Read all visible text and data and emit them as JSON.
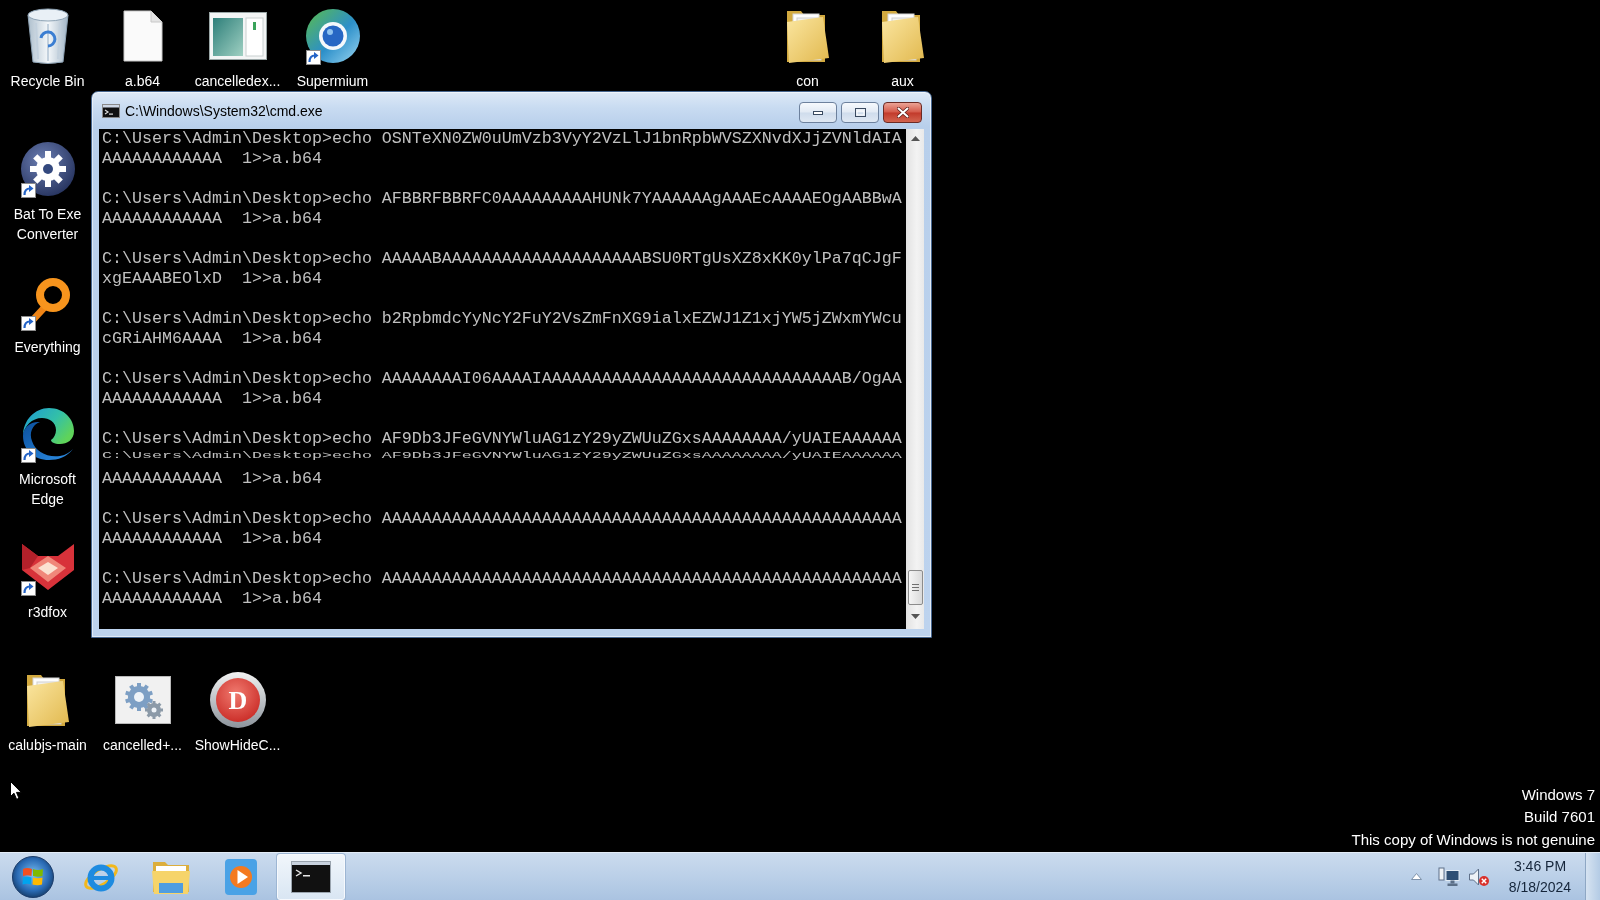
{
  "desktop_icons": [
    {
      "label": "Recycle Bin",
      "kind": "recycle-bin",
      "shortcut": false
    },
    {
      "label": "a.b64",
      "kind": "document",
      "shortcut": false
    },
    {
      "label": "cancelledex...",
      "kind": "thumbnail",
      "shortcut": false
    },
    {
      "label": "Supermium",
      "kind": "globe",
      "shortcut": true
    },
    {
      "label": "con",
      "kind": "folder",
      "shortcut": false
    },
    {
      "label": "aux",
      "kind": "folder",
      "shortcut": false
    },
    {
      "label": "Bat To Exe Converter",
      "kind": "gear",
      "shortcut": true
    },
    {
      "label": "Everything",
      "kind": "ring",
      "shortcut": true
    },
    {
      "label": "Microsoft Edge",
      "kind": "swirl",
      "shortcut": true
    },
    {
      "label": "r3dfox",
      "kind": "fox",
      "shortcut": true
    },
    {
      "label": "calubjs-main",
      "kind": "folder",
      "shortcut": false
    },
    {
      "label": "cancelled+...",
      "kind": "gears",
      "shortcut": false
    },
    {
      "label": "ShowHideC...",
      "kind": "letter-disc",
      "glyph": "D",
      "shortcut": false
    }
  ],
  "console_window": {
    "title": "C:\\Windows\\System32\\cmd.exe",
    "lines": [
      {
        "kind": "text",
        "text": "C:\\Users\\Admin\\Desktop>echo OSNTeXN0ZW0uUmVzb3VyY2VzLlJ1bnRpbWVSZXNvdXJjZVNldAIA"
      },
      {
        "kind": "text",
        "text": "AAAAAAAAAAAA  1>>a.b64"
      },
      {
        "kind": "blank"
      },
      {
        "kind": "text",
        "text": "C:\\Users\\Admin\\Desktop>echo AFBBRFBBRFC0AAAAAAAAAHUNk7YAAAAAAgAAAEcAAAAEOgAABBwA"
      },
      {
        "kind": "text",
        "text": "AAAAAAAAAAAA  1>>a.b64"
      },
      {
        "kind": "blank"
      },
      {
        "kind": "text",
        "text": "C:\\Users\\Admin\\Desktop>echo AAAAABAAAAAAAAAAAAAAAAAAAABSU0RTgUsXZ8xKK0ylPa7qCJgF"
      },
      {
        "kind": "text",
        "text": "xgEAAABEOlxD  1>>a.b64"
      },
      {
        "kind": "blank"
      },
      {
        "kind": "text",
        "text": "C:\\Users\\Admin\\Desktop>echo b2RpbmdcYyNcY2FuY2VsZmFnXG9ialxEZWJ1Z1xjYW5jZWxmYWcu"
      },
      {
        "kind": "text",
        "text": "cGRiAHM6AAAA  1>>a.b64"
      },
      {
        "kind": "blank"
      },
      {
        "kind": "text",
        "text": "C:\\Users\\Admin\\Desktop>echo AAAAAAAAI06AAAAIAAAAAAAAAAAAAAAAAAAAAAAAAAAAAAB/OgAA"
      },
      {
        "kind": "text",
        "text": "AAAAAAAAAAAA  1>>a.b64"
      },
      {
        "kind": "blank"
      },
      {
        "kind": "text",
        "text": "C:\\Users\\Admin\\Desktop>echo AF9Db3JFeGVNYWluAG1zY29yZWUuZGxsAAAAAAAA/yUAIEAAAAAA"
      },
      {
        "kind": "torn",
        "text": "C:\\Users\\Admin\\Desktop>echo AF9Db3JFeGVNYWluAG1zY29yZWUuZGxsAAAAAAAA/yUAIEAAAAAA"
      },
      {
        "kind": "text",
        "text": "AAAAAAAAAAAA  1>>a.b64"
      },
      {
        "kind": "blank"
      },
      {
        "kind": "text",
        "text": "C:\\Users\\Admin\\Desktop>echo AAAAAAAAAAAAAAAAAAAAAAAAAAAAAAAAAAAAAAAAAAAAAAAAAAAA"
      },
      {
        "kind": "text",
        "text": "AAAAAAAAAAAA  1>>a.b64"
      },
      {
        "kind": "blank"
      },
      {
        "kind": "text",
        "text": "C:\\Users\\Admin\\Desktop>echo AAAAAAAAAAAAAAAAAAAAAAAAAAAAAAAAAAAAAAAAAAAAAAAAAAAA"
      },
      {
        "kind": "text",
        "text": "AAAAAAAAAAAA  1>>a.b64"
      }
    ]
  },
  "notice": {
    "lines": [
      "Windows 7",
      "Build 7601",
      "This copy of Windows is not genuine"
    ]
  },
  "taskbar": {
    "items": [
      {
        "kind": "browser",
        "active": false
      },
      {
        "kind": "explorer",
        "active": false
      },
      {
        "kind": "media",
        "active": false
      },
      {
        "kind": "console",
        "active": true
      }
    ]
  },
  "tray": {
    "volume_muted": true,
    "time": "3:46 PM",
    "date": "8/18/2024"
  }
}
